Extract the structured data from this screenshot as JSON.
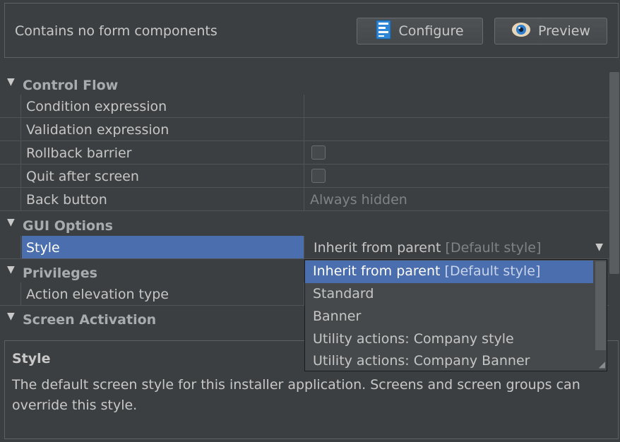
{
  "toolbar": {
    "message": "Contains no form components",
    "configure_label": "Configure",
    "preview_label": "Preview"
  },
  "sections": {
    "control_flow": {
      "title": "Control Flow",
      "condition_expression": "Condition expression",
      "validation_expression": "Validation expression",
      "rollback_barrier": "Rollback barrier",
      "quit_after_screen": "Quit after screen",
      "back_button": "Back button",
      "back_button_value": "Always hidden"
    },
    "gui_options": {
      "title": "GUI Options",
      "style": "Style",
      "style_value": "Inherit from parent",
      "style_value_hint": "[Default style]"
    },
    "privileges": {
      "title": "Privileges",
      "action_elevation_type": "Action elevation type"
    },
    "screen_activation": {
      "title": "Screen Activation"
    }
  },
  "style_dropdown": {
    "options": [
      {
        "label": "Inherit from parent",
        "hint": "[Default style]",
        "selected": true
      },
      {
        "label": "Standard",
        "hint": "",
        "selected": false
      },
      {
        "label": "Banner",
        "hint": "",
        "selected": false
      },
      {
        "label": "Utility actions: Company style",
        "hint": "",
        "selected": false
      },
      {
        "label": "Utility actions: Company Banner",
        "hint": "",
        "selected": false
      }
    ]
  },
  "help": {
    "title": "Style",
    "description": "The default screen style for this installer application. Screens and screen groups can override this style."
  },
  "icons": {
    "configure": "form-configure-icon",
    "preview": "eye-icon",
    "expand": "triangle-down-icon",
    "dropdown": "chevron-down-icon"
  },
  "colors": {
    "background": "#3c3f41",
    "selection": "#4b6eaf",
    "text": "#c6c6c6",
    "muted": "#7f8385"
  }
}
